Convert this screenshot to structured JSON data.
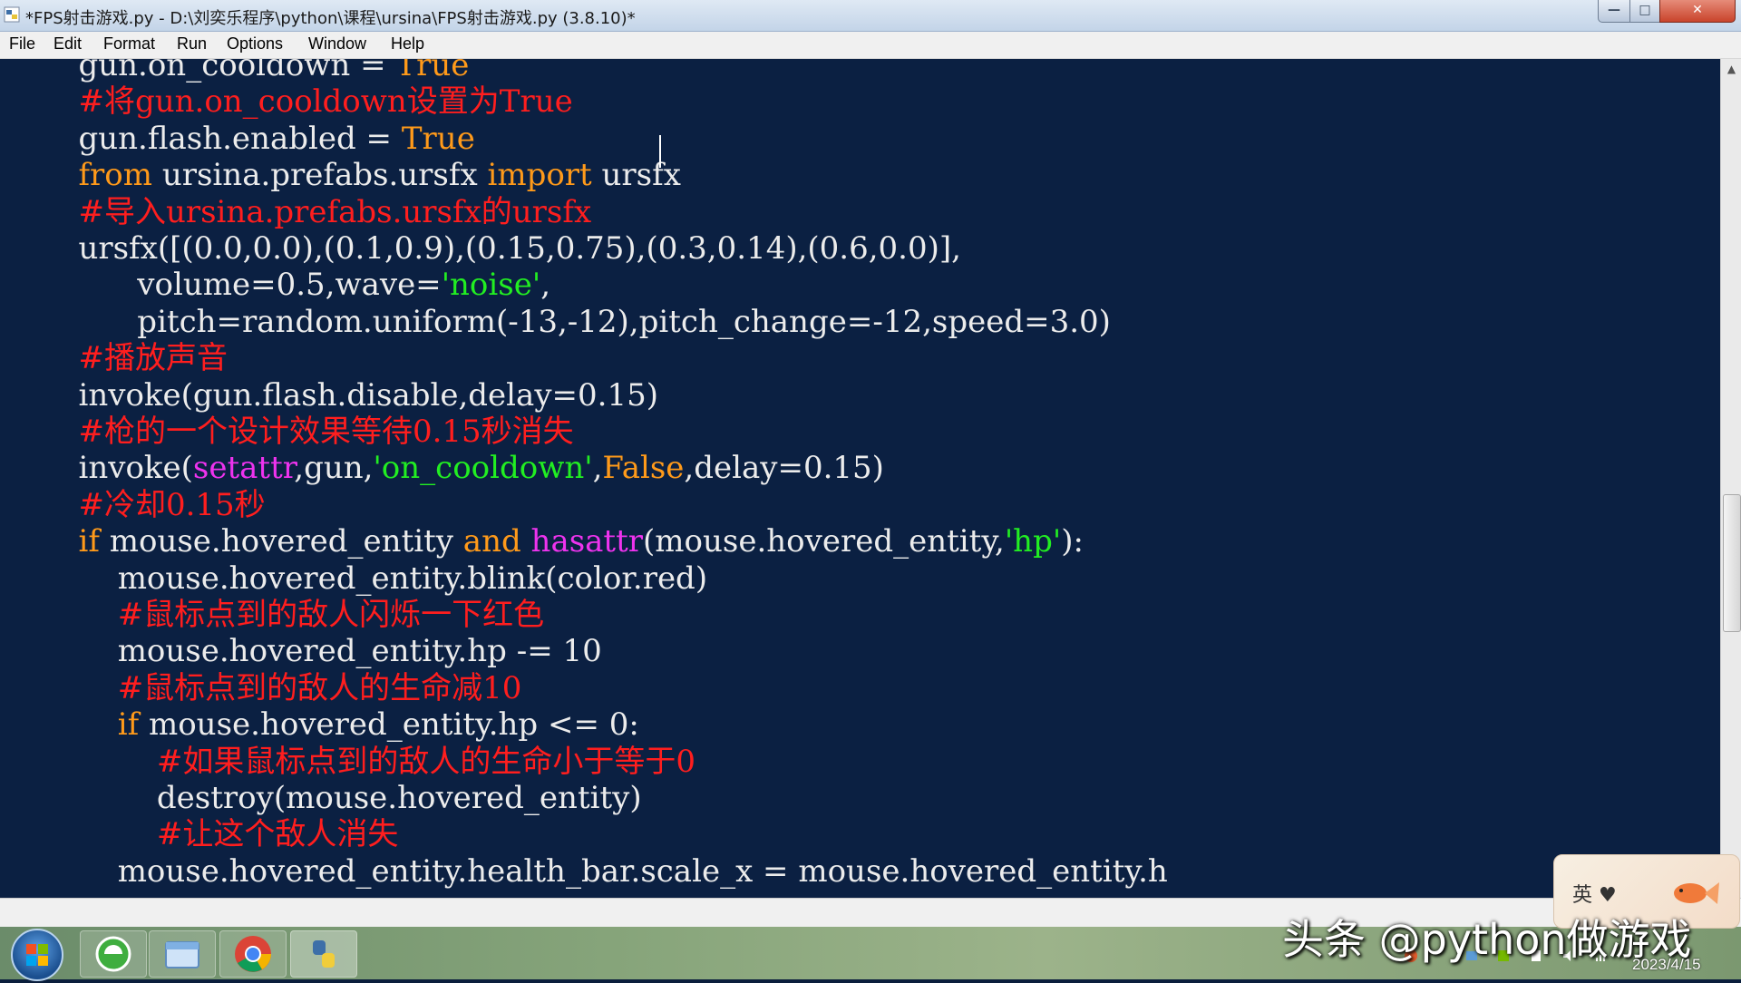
{
  "window": {
    "title": "*FPS射击游戏.py - D:\\刘奕乐程序\\python\\课程\\ursina\\FPS射击游戏.py (3.8.10)*",
    "minimize_label": "—",
    "maximize_label": "□",
    "close_label": "✕"
  },
  "menu": {
    "items": [
      "File",
      "Edit",
      "Format",
      "Run",
      "Options",
      "Window",
      "Help"
    ]
  },
  "editor": {
    "lines": [
      [
        [
          "t-plain",
          "        gun.on_cooldown = "
        ],
        [
          "t-kw",
          "True"
        ]
      ],
      [
        [
          "t-cm",
          "        #将gun.on_cooldown设置为True"
        ]
      ],
      [
        [
          "t-plain",
          "        gun.flash.enabled = "
        ],
        [
          "t-kw",
          "True"
        ]
      ],
      [
        [
          "t-kw",
          "        from"
        ],
        [
          "t-plain",
          " ursina.prefabs.ursfx "
        ],
        [
          "t-kw",
          "import"
        ],
        [
          "t-plain",
          " ursfx"
        ]
      ],
      [
        [
          "t-cm",
          "        #导入ursina.prefabs.ursfx的ursfx"
        ]
      ],
      [
        [
          "t-plain",
          "        ursfx([(0.0,0.0),(0.1,0.9),(0.15,0.75),(0.3,0.14),(0.6,0.0)],"
        ]
      ],
      [
        [
          "t-plain",
          "              volume=0.5,wave="
        ],
        [
          "t-str",
          "'noise'"
        ],
        [
          "t-plain",
          ","
        ]
      ],
      [
        [
          "t-plain",
          "              pitch=random.uniform(-13,-12),pitch_change=-12,speed=3.0)"
        ]
      ],
      [
        [
          "t-cm",
          "        #播放声音"
        ]
      ],
      [
        [
          "t-plain",
          "        invoke(gun.flash.disable,delay=0.15)"
        ]
      ],
      [
        [
          "t-cm",
          "        #枪的一个设计效果等待0.15秒消失"
        ]
      ],
      [
        [
          "t-plain",
          "        invoke("
        ],
        [
          "t-bi",
          "setattr"
        ],
        [
          "t-plain",
          ",gun,"
        ],
        [
          "t-str",
          "'on_cooldown'"
        ],
        [
          "t-plain",
          ","
        ],
        [
          "t-kw",
          "False"
        ],
        [
          "t-plain",
          ",delay=0.15)"
        ]
      ],
      [
        [
          "t-cm",
          "        #冷却0.15秒"
        ]
      ],
      [
        [
          "t-kw",
          "        if"
        ],
        [
          "t-plain",
          " mouse.hovered_entity "
        ],
        [
          "t-kw",
          "and"
        ],
        [
          "t-plain",
          " "
        ],
        [
          "t-bi",
          "hasattr"
        ],
        [
          "t-plain",
          "(mouse.hovered_entity,"
        ],
        [
          "t-str",
          "'hp'"
        ],
        [
          "t-plain",
          "):"
        ]
      ],
      [
        [
          "t-plain",
          "            mouse.hovered_entity.blink(color.red)"
        ]
      ],
      [
        [
          "t-cm",
          "            #鼠标点到的敌人闪烁一下红色"
        ]
      ],
      [
        [
          "t-plain",
          "            mouse.hovered_entity.hp -= 10"
        ]
      ],
      [
        [
          "t-cm",
          "            #鼠标点到的敌人的生命减10"
        ]
      ],
      [
        [
          "t-kw",
          "            if"
        ],
        [
          "t-plain",
          " mouse.hovered_entity.hp <= 0:"
        ]
      ],
      [
        [
          "t-cm",
          "                #如果鼠标点到的敌人的生命小于等于0"
        ]
      ],
      [
        [
          "t-plain",
          "                destroy(mouse.hovered_entity)"
        ]
      ],
      [
        [
          "t-cm",
          "                #让这个敌人消失"
        ]
      ],
      [
        [
          "t-plain",
          "            mouse.hovered_entity.health_bar.scale_x = mouse.hovered_entity.h"
        ]
      ]
    ]
  },
  "tray": {
    "ime_label": "英 ♥",
    "date": "2023/4/15"
  },
  "watermark": "头条 @python做游戏",
  "colors": {
    "editor_bg": "#0b2042",
    "keyword": "#ff9a1a",
    "comment": "#ff1e1e",
    "string": "#22ee22",
    "builtin": "#ee33ee",
    "plain": "#ececec"
  }
}
